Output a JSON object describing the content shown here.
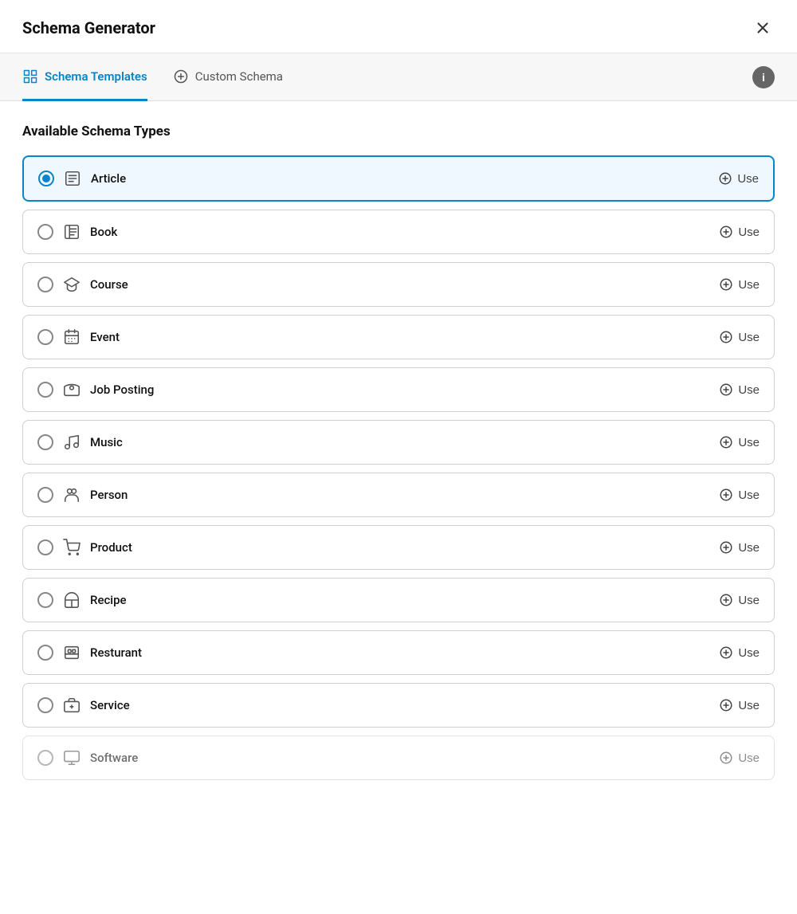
{
  "header": {
    "title": "Schema Generator",
    "close_label": "close"
  },
  "tabs": [
    {
      "id": "schema-templates",
      "label": "Schema Templates",
      "active": true
    },
    {
      "id": "custom-schema",
      "label": "Custom Schema",
      "active": false
    }
  ],
  "info_button_label": "i",
  "section": {
    "title": "Available Schema Types"
  },
  "schema_items": [
    {
      "id": "article",
      "label": "Article",
      "selected": true,
      "use_label": "Use"
    },
    {
      "id": "book",
      "label": "Book",
      "selected": false,
      "use_label": "Use"
    },
    {
      "id": "course",
      "label": "Course",
      "selected": false,
      "use_label": "Use"
    },
    {
      "id": "event",
      "label": "Event",
      "selected": false,
      "use_label": "Use"
    },
    {
      "id": "job-posting",
      "label": "Job Posting",
      "selected": false,
      "use_label": "Use"
    },
    {
      "id": "music",
      "label": "Music",
      "selected": false,
      "use_label": "Use"
    },
    {
      "id": "person",
      "label": "Person",
      "selected": false,
      "use_label": "Use"
    },
    {
      "id": "product",
      "label": "Product",
      "selected": false,
      "use_label": "Use"
    },
    {
      "id": "recipe",
      "label": "Recipe",
      "selected": false,
      "use_label": "Use"
    },
    {
      "id": "resturant",
      "label": "Resturant",
      "selected": false,
      "use_label": "Use"
    },
    {
      "id": "service",
      "label": "Service",
      "selected": false,
      "use_label": "Use"
    },
    {
      "id": "software",
      "label": "Software",
      "selected": false,
      "use_label": "Use"
    }
  ]
}
